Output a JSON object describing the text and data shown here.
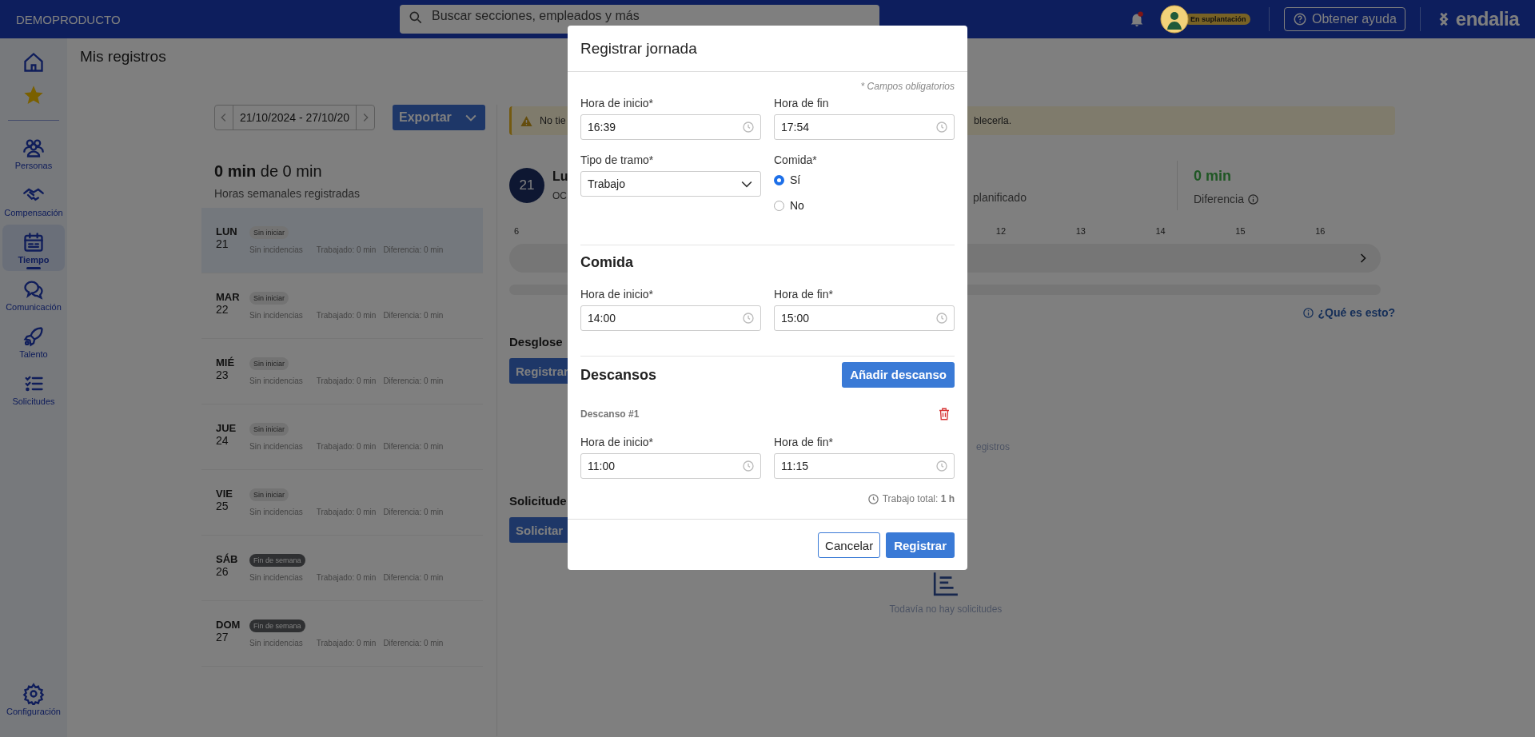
{
  "topbar": {
    "brand": "DEMOPRODUCTO",
    "search": {
      "placeholder": "Buscar secciones, empleados y más"
    },
    "impersonation_badge": "En suplantación",
    "help_button": "Obtener ayuda",
    "logo": "endalia"
  },
  "sidebar": {
    "items": [
      {
        "label": "Personas",
        "selected": false
      },
      {
        "label": "Compensación",
        "selected": false
      },
      {
        "label": "Tiempo",
        "selected": true
      },
      {
        "label": "Comunicación",
        "selected": false
      },
      {
        "label": "Talento",
        "selected": false
      },
      {
        "label": "Solicitudes",
        "selected": false
      }
    ],
    "footer_item": {
      "label": "Configuración"
    }
  },
  "page": {
    "title": "Mis registros"
  },
  "week": {
    "range": "21/10/2024 - 27/10/20",
    "export_button": "Exportar",
    "total": "**0 min** de 0 min",
    "subtitle": "Horas semanales registradas"
  },
  "days": [
    {
      "day": "LUN",
      "date": "21",
      "status": "Sin iniciar",
      "kind": "pending",
      "incidents": "Sin incidencias",
      "worked": "Trabajado: 0 min",
      "difference": "Diferencia: 0 min",
      "selected": true
    },
    {
      "day": "MAR",
      "date": "22",
      "status": "Sin iniciar",
      "kind": "pending",
      "incidents": "Sin incidencias",
      "worked": "Trabajado: 0 min",
      "difference": "Diferencia: 0 min",
      "selected": false
    },
    {
      "day": "MIÉ",
      "date": "23",
      "status": "Sin iniciar",
      "kind": "pending",
      "incidents": "Sin incidencias",
      "worked": "Trabajado: 0 min",
      "difference": "Diferencia: 0 min",
      "selected": false
    },
    {
      "day": "JUE",
      "date": "24",
      "status": "Sin iniciar",
      "kind": "pending",
      "incidents": "Sin incidencias",
      "worked": "Trabajado: 0 min",
      "difference": "Diferencia: 0 min",
      "selected": false
    },
    {
      "day": "VIE",
      "date": "25",
      "status": "Sin iniciar",
      "kind": "pending",
      "incidents": "Sin incidencias",
      "worked": "Trabajado: 0 min",
      "difference": "Diferencia: 0 min",
      "selected": false
    },
    {
      "day": "SÁB",
      "date": "26",
      "status": "Fin de semana",
      "kind": "weekend",
      "incidents": "Sin incidencias",
      "worked": "Trabajado: 0 min",
      "difference": "Diferencia: 0 min",
      "selected": false
    },
    {
      "day": "DOM",
      "date": "27",
      "status": "Fin de semana",
      "kind": "weekend",
      "incidents": "Sin incidencias",
      "worked": "Trabajado: 0 min",
      "difference": "Diferencia: 0 min",
      "selected": false
    }
  ],
  "banner": {
    "text_start": "No tie",
    "text_end": "blecerla."
  },
  "day_card": {
    "date": "21",
    "title": "Lu",
    "subtitle": "OC",
    "planned_label": "planificado",
    "difference_value": "0 min",
    "difference_label": "Diferencia"
  },
  "timeline": {
    "ticks": [
      "6",
      "12",
      "13",
      "14",
      "15",
      "16"
    ]
  },
  "help_link": "¿Qué es esto?",
  "breakdown": {
    "heading": "Desglose",
    "button": "Registrar",
    "empty_text": "egistros"
  },
  "requests": {
    "heading": "Solicitude",
    "button": "Solicitar",
    "empty_text": "Todavía no hay solicitudes"
  },
  "modal": {
    "title": "Registrar jornada",
    "required_note": "* Campos obligatorios",
    "fields": [
      {
        "label": "Hora de inicio*",
        "value": "16:39"
      },
      {
        "label": "Hora de fin",
        "value": "17:54"
      }
    ],
    "segment_type": {
      "label": "Tipo de tramo*",
      "value": "Trabajo"
    },
    "meal": {
      "label": "Comida*",
      "options": [
        {
          "label": "Sí",
          "selected": true
        },
        {
          "label": "No",
          "selected": false
        }
      ]
    },
    "meal_section": {
      "heading": "Comida",
      "fields": [
        {
          "label": "Hora de inicio*",
          "value": "14:00"
        },
        {
          "label": "Hora de fin*",
          "value": "15:00"
        }
      ]
    },
    "breaks_section": {
      "heading": "Descansos",
      "add_button": "Añadir descanso",
      "breaks": [
        {
          "title": "Descanso #1",
          "fields": [
            {
              "label": "Hora de inicio*",
              "value": "11:00"
            },
            {
              "label": "Hora de fin*",
              "value": "11:15"
            }
          ]
        }
      ]
    },
    "total": "Trabajo total: **1 h**",
    "buttons": {
      "cancel": "Cancelar",
      "submit": "Registrar"
    }
  }
}
